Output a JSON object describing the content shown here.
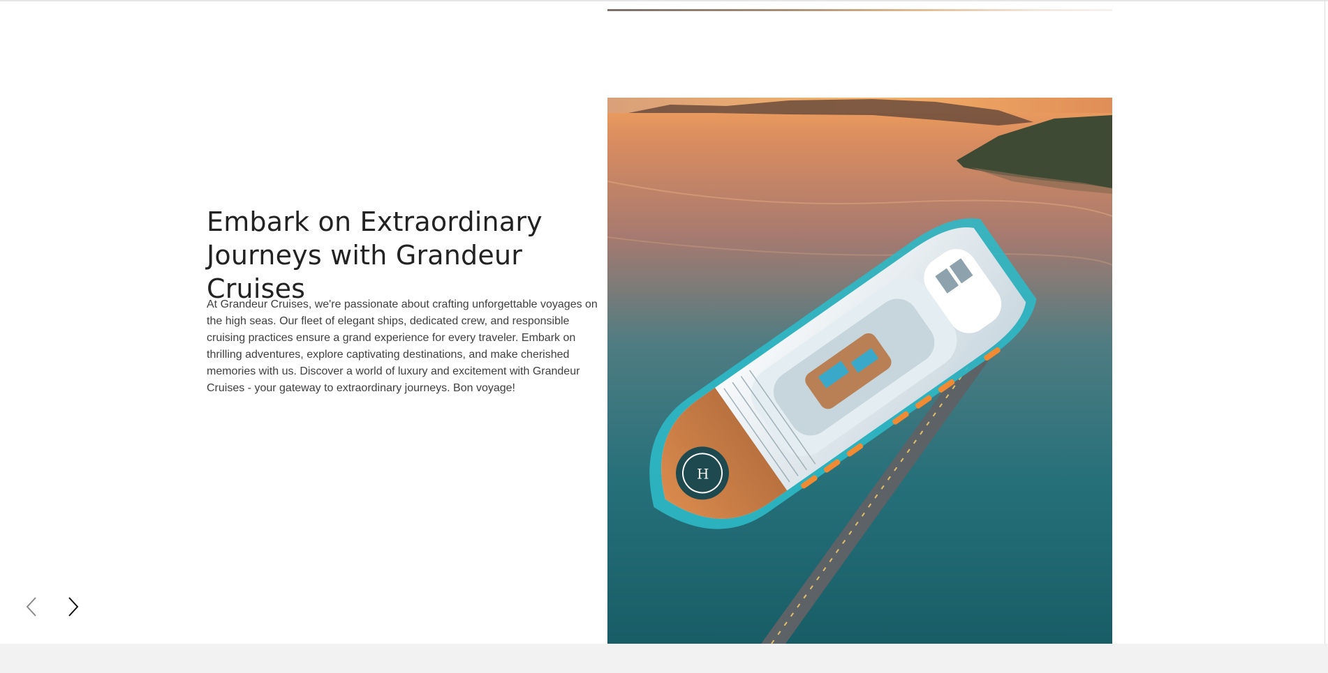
{
  "hero": {
    "title": "Embark on Extraordinary Journeys with Grandeur Cruises",
    "description": "At Grandeur Cruises, we're passionate about crafting unforgettable voyages on the high seas. Our fleet of elegant ships, dedicated crew, and responsible cruising practices ensure a grand experience for every traveler. Embark on thrilling adventures, explore captivating destinations, and make cherished memories with us. Discover a world of luxury and excitement with Grandeur Cruises - your gateway to extraordinary journeys. Bon voyage!",
    "image_label": "H"
  },
  "slider": {
    "prev_icon": "chevron-left-icon",
    "next_icon": "chevron-right-icon"
  },
  "colors": {
    "text_primary": "#222222",
    "text_body": "#3f3f3f",
    "footer_band": "#f2f2f2",
    "sea": "#1f6f78",
    "sunset": "#e9975a"
  }
}
